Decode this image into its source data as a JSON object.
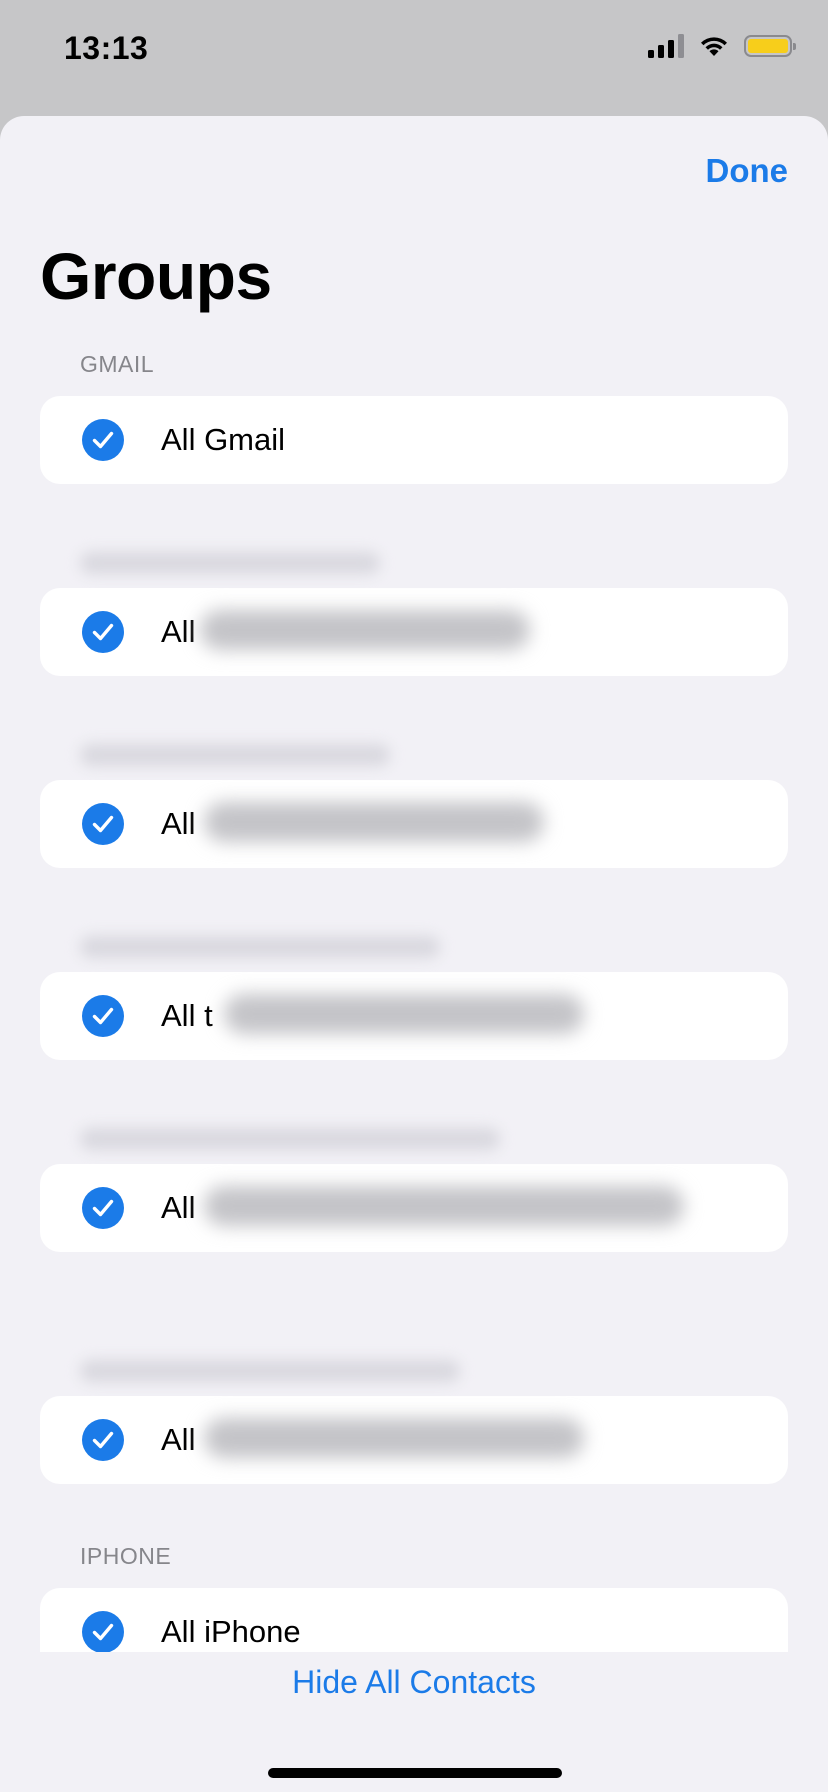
{
  "status_bar": {
    "time": "13:13",
    "icons": [
      "signal-icon",
      "wifi-icon",
      "battery-icon"
    ],
    "battery_color": "#f7ce1b"
  },
  "header": {
    "done_label": "Done",
    "title": "Groups"
  },
  "sections": {
    "gmail_header": "GMAIL",
    "iphone_header": "IPHONE"
  },
  "groups": [
    {
      "label": "All Gmail",
      "checked": true
    },
    {
      "label": "All",
      "checked": true
    },
    {
      "label": "All",
      "checked": true
    },
    {
      "label": "All t",
      "checked": true
    },
    {
      "label": "All",
      "checked": true
    },
    {
      "label": "All",
      "checked": true
    },
    {
      "label": "All iPhone",
      "checked": true
    }
  ],
  "footer": {
    "hide_all_label": "Hide All Contacts"
  },
  "colors": {
    "accent": "#1b7be8",
    "sheet_background": "#f2f1f6",
    "row_background": "#ffffff",
    "section_header": "#86868b"
  }
}
